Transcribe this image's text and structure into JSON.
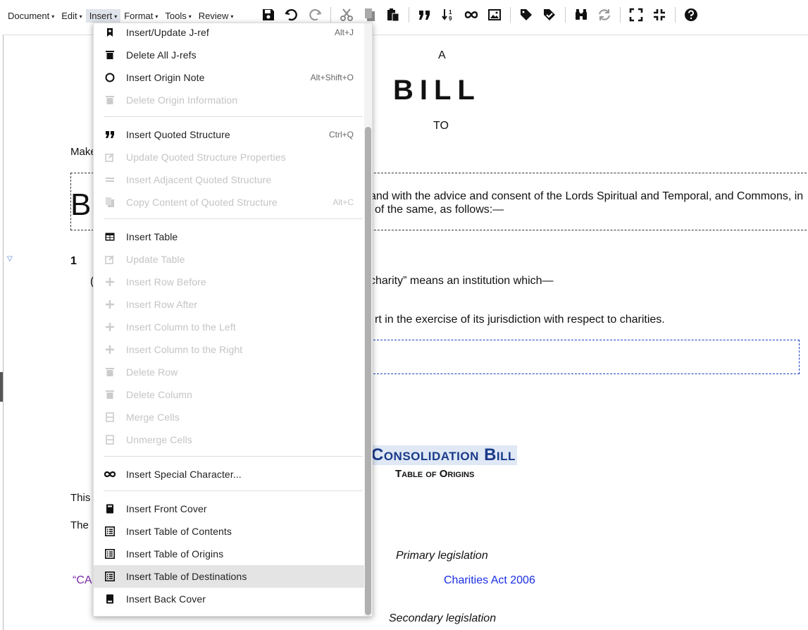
{
  "menubar": {
    "items": [
      {
        "label": "Document"
      },
      {
        "label": "Edit"
      },
      {
        "label": "Insert"
      },
      {
        "label": "Format"
      },
      {
        "label": "Tools"
      },
      {
        "label": "Review"
      }
    ],
    "caret": "▾"
  },
  "document": {
    "a_label": "A",
    "bill_title": "BILL",
    "to_label": "TO",
    "make_fragment": "Make",
    "big_b": "B",
    "enacting_line1": "and with the advice and consent of the Lords Spiritual and Temporal, and Commons, in",
    "enacting_line2": "of the same, as follows:—",
    "section_number": "1",
    "paren_fragment": "(",
    "charity_line": "charity” means an institution which—",
    "court_line": "rt in the exercise of its jurisdiction with respect to charities.",
    "consolidation_title": "Consolidation Bill",
    "table_of_origins": "Table of Origins",
    "this_fragment": "This",
    "the_fragment": "The",
    "primary_legislation": "Primary legislation",
    "ca_fragment": "“CA",
    "charities_act": "Charities Act 2006",
    "secondary_legislation": "Secondary legislation"
  },
  "dropdown": {
    "items": [
      {
        "label": "Insert/Update J-ref",
        "shortcut": "Alt+J",
        "icon": "bookmark-icon",
        "disabled": false
      },
      {
        "label": "Delete All J-refs",
        "shortcut": "",
        "icon": "trash-icon",
        "disabled": false
      },
      {
        "label": "Insert Origin Note",
        "shortcut": "Alt+Shift+O",
        "icon": "circle-icon",
        "disabled": false
      },
      {
        "label": "Delete Origin Information",
        "shortcut": "",
        "icon": "trash-icon",
        "disabled": true
      },
      {
        "label": "Insert Quoted Structure",
        "shortcut": "Ctrl+Q",
        "icon": "quote-icon",
        "disabled": false
      },
      {
        "label": "Update Quoted Structure Properties",
        "shortcut": "",
        "icon": "edit-icon",
        "disabled": true
      },
      {
        "label": "Insert Adjacent Quoted Structure",
        "shortcut": "",
        "icon": "equals-icon",
        "disabled": true
      },
      {
        "label": "Copy Content of Quoted Structure",
        "shortcut": "Alt+C",
        "icon": "copy-icon",
        "disabled": true
      },
      {
        "label": "Insert Table",
        "shortcut": "",
        "icon": "table-icon",
        "disabled": false
      },
      {
        "label": "Update Table",
        "shortcut": "",
        "icon": "edit-icon",
        "disabled": true
      },
      {
        "label": "Insert Row Before",
        "shortcut": "",
        "icon": "plus-icon",
        "disabled": true
      },
      {
        "label": "Insert Row After",
        "shortcut": "",
        "icon": "plus-icon",
        "disabled": true
      },
      {
        "label": "Insert Column to the Left",
        "shortcut": "",
        "icon": "plus-icon",
        "disabled": true
      },
      {
        "label": "Insert Column to the Right",
        "shortcut": "",
        "icon": "plus-icon",
        "disabled": true
      },
      {
        "label": "Delete Row",
        "shortcut": "",
        "icon": "trash-icon",
        "disabled": true
      },
      {
        "label": "Delete Column",
        "shortcut": "",
        "icon": "trash-icon",
        "disabled": true
      },
      {
        "label": "Merge Cells",
        "shortcut": "",
        "icon": "merge-icon",
        "disabled": true
      },
      {
        "label": "Unmerge Cells",
        "shortcut": "",
        "icon": "merge-icon",
        "disabled": true
      },
      {
        "label": "Insert Special Character...",
        "shortcut": "",
        "icon": "infinity-icon",
        "disabled": false
      },
      {
        "label": "Insert Front Cover",
        "shortcut": "",
        "icon": "book-icon",
        "disabled": false
      },
      {
        "label": "Insert Table of Contents",
        "shortcut": "",
        "icon": "list-icon",
        "disabled": false
      },
      {
        "label": "Insert Table of Origins",
        "shortcut": "",
        "icon": "list-icon",
        "disabled": false
      },
      {
        "label": "Insert Table of Destinations",
        "shortcut": "",
        "icon": "list-icon",
        "disabled": false
      },
      {
        "label": "Insert Back Cover",
        "shortcut": "",
        "icon": "book-icon",
        "disabled": false
      }
    ]
  },
  "colors": {
    "accent_blue": "#1a3a8a",
    "link_blue": "#1a2ee6",
    "purple": "#7a2aa6",
    "highlight": "#dfe3ea"
  }
}
